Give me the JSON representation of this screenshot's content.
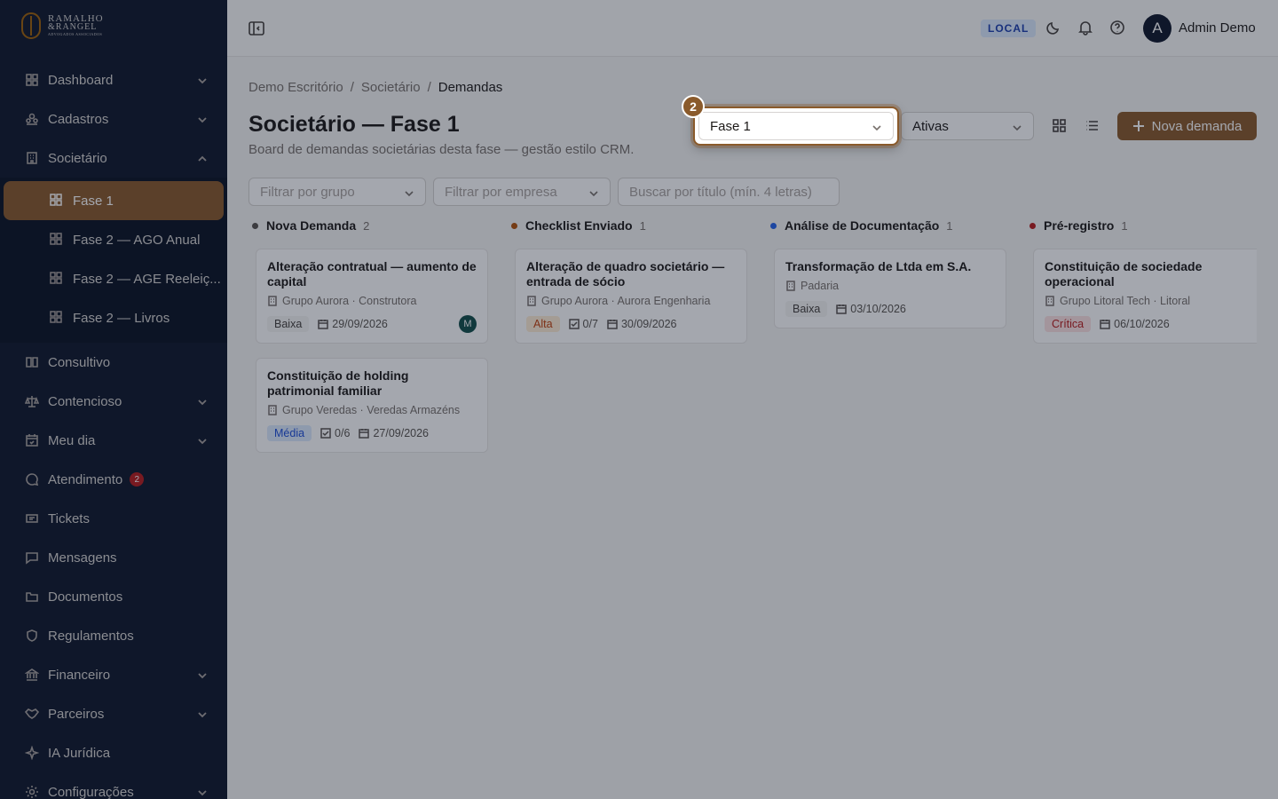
{
  "brand": {
    "line1": "RAMALHO",
    "line2": "&RANGEL",
    "line3": "ADVOGADOS ASSOCIADOS"
  },
  "sidebar": {
    "items": [
      {
        "label": "Dashboard",
        "icon": "grid-icon",
        "chevron": "down"
      },
      {
        "label": "Cadastros",
        "icon": "users-icon",
        "chevron": "down"
      },
      {
        "label": "Societário",
        "icon": "building-icon",
        "chevron": "up"
      }
    ],
    "sub_items": [
      {
        "label": "Fase 1",
        "active": true
      },
      {
        "label": "Fase 2 — AGO Anual"
      },
      {
        "label": "Fase 2 — AGE Reeleiç..."
      },
      {
        "label": "Fase 2 — Livros"
      }
    ],
    "items_after": [
      {
        "label": "Consultivo",
        "icon": "book-icon"
      },
      {
        "label": "Contencioso",
        "icon": "scale-icon",
        "chevron": "down"
      },
      {
        "label": "Meu dia",
        "icon": "calendar-icon",
        "chevron": "down"
      },
      {
        "label": "Atendimento",
        "icon": "chat-icon",
        "badge": "2"
      },
      {
        "label": "Tickets",
        "icon": "ticket-icon"
      },
      {
        "label": "Mensagens",
        "icon": "message-icon"
      },
      {
        "label": "Documentos",
        "icon": "folder-icon"
      },
      {
        "label": "Regulamentos",
        "icon": "shield-icon"
      },
      {
        "label": "Financeiro",
        "icon": "bank-icon",
        "chevron": "down"
      },
      {
        "label": "Parceiros",
        "icon": "handshake-icon",
        "chevron": "down"
      },
      {
        "label": "IA Jurídica",
        "icon": "sparkle-icon"
      },
      {
        "label": "Configurações",
        "icon": "gear-icon",
        "chevron": "down"
      }
    ]
  },
  "topbar": {
    "env_badge": "LOCAL",
    "avatar_initial": "A",
    "user_name": "Admin Demo"
  },
  "breadcrumb": [
    "Demo Escritório",
    "Societário",
    "Demandas"
  ],
  "page": {
    "title": "Societário — Fase 1",
    "subtitle": "Board de demandas societárias desta fase — gestão estilo CRM."
  },
  "filters": {
    "phase_select": "Fase 1",
    "status_select": "Ativas",
    "group_placeholder": "Filtrar por grupo",
    "company_placeholder": "Filtrar por empresa",
    "search_placeholder": "Buscar por título (mín. 4 letras)",
    "new_button": "Nova demanda"
  },
  "tour": {
    "step": "2"
  },
  "colors": {
    "accent": "#8a5a2b",
    "col_nova": "#57534e",
    "col_checklist": "#b45309",
    "col_analise": "#2563eb",
    "col_pre": "#b91c1c"
  },
  "columns": [
    {
      "name": "Nova Demanda",
      "count": "2",
      "cards": [
        {
          "title": "Alteração contratual — aumento de capital",
          "org": "Grupo Aurora · Construtora",
          "priority": "Baixa",
          "date": "29/09/2026",
          "assignee": "M"
        },
        {
          "title": "Constituição de holding patrimonial familiar",
          "org": "Grupo Veredas · Veredas Armazéns",
          "priority": "Média",
          "checklist": "0/6",
          "date": "27/09/2026"
        }
      ]
    },
    {
      "name": "Checklist Enviado",
      "count": "1",
      "cards": [
        {
          "title": "Alteração de quadro societário — entrada de sócio",
          "org": "Grupo Aurora · Aurora Engenharia",
          "priority": "Alta",
          "checklist": "0/7",
          "date": "30/09/2026"
        }
      ]
    },
    {
      "name": "Análise de Documentação",
      "count": "1",
      "cards": [
        {
          "title": "Transformação de Ltda em S.A.",
          "org": "Padaria",
          "priority": "Baixa",
          "date": "03/10/2026"
        }
      ]
    },
    {
      "name": "Pré-registro",
      "count": "1",
      "cards": [
        {
          "title": "Constituição de sociedade operacional",
          "org": "Grupo Litoral Tech · Litoral",
          "priority": "Crítica",
          "date": "06/10/2026"
        }
      ]
    }
  ]
}
